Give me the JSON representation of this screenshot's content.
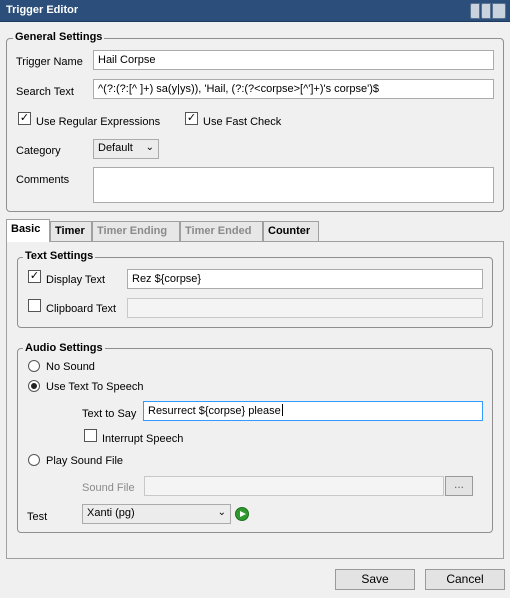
{
  "window": {
    "title": "Trigger Editor"
  },
  "general": {
    "group_title": "General Settings",
    "trigger_name_label": "Trigger Name",
    "trigger_name_value": "Hail Corpse",
    "search_text_label": "Search Text",
    "search_text_value": "^(?:(?:[^ ]+) sa(y|ys)), 'Hail, (?:(?<corpse>[^']+)'s corpse')$",
    "use_regex_label": "Use Regular Expressions",
    "use_regex_checked": true,
    "fast_check_label": "Use Fast Check",
    "fast_check_checked": true,
    "category_label": "Category",
    "category_value": "Default",
    "comments_label": "Comments",
    "comments_value": ""
  },
  "tabs": [
    {
      "label": "Basic",
      "state": "active"
    },
    {
      "label": "Timer",
      "state": "enabled"
    },
    {
      "label": "Timer Ending",
      "state": "disabled"
    },
    {
      "label": "Timer Ended",
      "state": "disabled"
    },
    {
      "label": "Counter",
      "state": "enabled"
    }
  ],
  "text_settings": {
    "group_title": "Text Settings",
    "display_text_label": "Display Text",
    "display_text_checked": true,
    "display_text_value": "Rez ${corpse}",
    "clipboard_text_label": "Clipboard Text",
    "clipboard_text_checked": false,
    "clipboard_text_value": ""
  },
  "audio_settings": {
    "group_title": "Audio Settings",
    "no_sound_label": "No Sound",
    "tts_label": "Use Text To Speech",
    "selected": "tts",
    "text_to_say_label": "Text to Say",
    "text_to_say_value": "Resurrect ${corpse} please",
    "interrupt_label": "Interrupt Speech",
    "interrupt_checked": false,
    "play_sound_label": "Play Sound File",
    "sound_file_label": "Sound File",
    "sound_file_value": "",
    "browse_label": "...",
    "test_label": "Test",
    "voice_value": "Xanti (pg)"
  },
  "footer": {
    "save_label": "Save",
    "cancel_label": "Cancel"
  },
  "colors": {
    "titlebar": "#2b4f7a",
    "play": "#2e9a2e",
    "focus": "#3399ff"
  },
  "icons": [
    "window-buttons-icon",
    "check-icon",
    "chevron-down-icon",
    "play-icon"
  ]
}
